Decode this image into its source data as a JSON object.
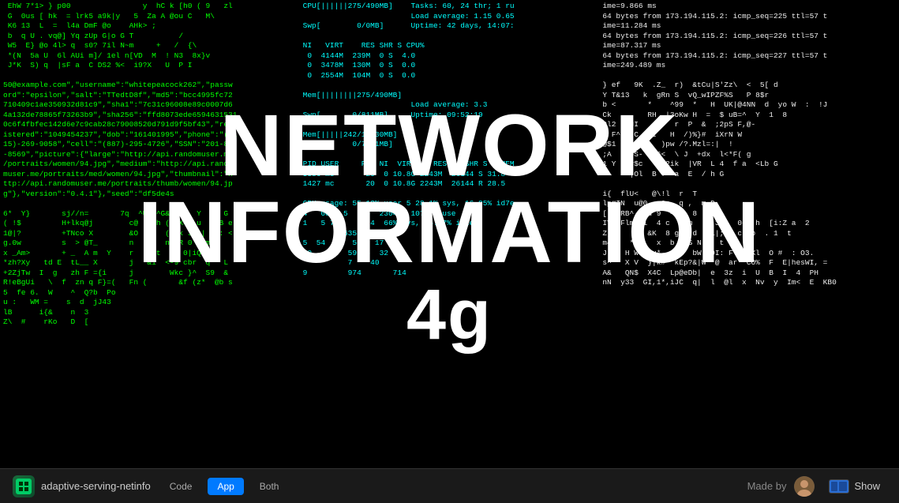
{
  "app": {
    "name": "adaptive-serving-netinfo",
    "icon_label": "net"
  },
  "tabs": [
    {
      "id": "code",
      "label": "Code",
      "active": false
    },
    {
      "id": "app",
      "label": "App",
      "active": true
    },
    {
      "id": "both",
      "label": "Both",
      "active": false
    }
  ],
  "overlay": {
    "line1": "NETWORK",
    "line2": "INFORMATION",
    "line3": "4g"
  },
  "bottom_right": {
    "made_by": "Made by",
    "show_label": "Show"
  },
  "terminal": {
    "col1_lines": [
      " EhW 7*1> } p00                y  hC k [h0 ( 9   zl",
      " G  0us [ hk  = lrk5 a9k|y   5  Za A @ou C   M\\",
      " K6 13  L  =  l4a DmF @o    AHk> ;                ",
      " b  q U . vq@] Yq zUp G|o G T          / ",
      " W5  E} @o 4l> q  s0? 7il N~m     +   /  {\\",
      " *(N  5a U  6l AUi m]/ 1el n[VD  M  ! N3  8x}v",
      " J*K  S) q  |sF a  C DS2 %<  i9?X   U  P I",
      "",
      "50@example.com\",\"username\":\"whitepeacock262\",\"passw",
      "ord\":\"epsilon\",\"salt\":\"TTedtD8f\",\"md5\":\"bcc4995fc72",
      "710409c1ae350932d81c9\",\"sha1\":\"7c31c96008e89c0007d6",
      "4a132de78865f73263b9\",\"sha256\":\"ffd8073ede6594631531",
      "0c6f4fbfec142d6e7c9cab28c79008520d791d9f5bf43\",\"reg",
      "istered\":\"1049454237\",\"dob\":\"161401995\",\"phone\":\"(31",
      "15)-269-9058\",\"cell\":\"(887)-295-4726\",\"SSN\":\"201-89",
      "-8569\",\"picture\":{\"large\":\"http://api.randomuser.me",
      "/portraits/women/94.jpg\",\"medium\":\"http://api.rando",
      "muser.me/portraits/med/women/94.jpg\",\"thumbnail\":\"h",
      "ttp://api.randomuser.me/portraits/thumb/women/94.jp",
      "g\"},\"version\":\"0.4.1\"},\"seed\":\"df5de4s",
      "",
      "6*  Y}       sj//n=       7q  ^U  ^G&F}!_  Y  ^K G",
      "( !$         H+lkq@j        c@   ah (X/X=  u  ^ B e S",
      "1@|?         +TNco X        &O   d  ( ok J?]| 1 : < ( D",
      "g.0w         s  > @T_       n    (  n* R 0  _m",
      "x _Am>       + _  A m  Y    r  - _t  'i 0|iQ M l",
      "*zh?Xy   td E  tL__ X       j   &i  <-9 cbr  q   L",
      "+2ZjTw  I  g   zh F ={i     j        Wkc }^  S9  &",
      "R!eBgUi   \\  f  zn q F}=(   Fn (       &f (z*  @b s",
      "5  fe 6.  W    ^  Q?b  Po",
      "u :   WM =    s  d  jJ43",
      "lB      i{&    n  3     ",
      "Z\\  #    rKo   D  [     "
    ],
    "col2_lines": [
      "CPU[||||||275/490MB]    Tasks: 60, 24 thr; 1 ru",
      "                        Load average: 1.15 0.65",
      "Swp[        0/0MB]      Uptime: 42 days, 14:07:",
      "",
      "NI   VIRT    RES SHR S CPU%",
      " 0  4144M  239M  0 S  4.0",
      " 0  3478M  130M  0 S  0.0",
      " 0  2554M  104M  0 S  0.0",
      "",
      "Mem[||||||||275/490MB]",
      "                        Load average: 3.3",
      "Swp[       0/811MB]     Uptime: 09:52:19",
      "",
      "Mem[|||||242/15930MB]",
      "Swp[       0/7811MB]",
      "",
      "PID USER     PRI NI  VIRT    RES    SHR S  %MEM",
      "3386 mc       20  0 10.8G 2243M  26144 S 31.8",
      "1427 mc       20  0 10.8G 2243M  26144 R 28.5",
      "",
      "CPU usage: 55.12% user 5 28.1% sys, 16.85% id7e",
      "4   0832 5   35  2304   107M unuse",
      "1   5 750    594  66% sys, 15.57% idle",
      "         63538",
      "5  54  4   56   17",
      "60        59 65  32",
      "          7    40",
      "9         974       714"
    ],
    "col3_lines": [
      "ime=9.866 ms",
      "64 bytes from 173.194.115.2: icmp_seq=225 ttl=57 t",
      "ime=11.284 ms",
      "64 bytes from 173.194.115.2: icmp_seq=226 ttl=57 t",
      "ime=87.317 ms",
      "64 bytes from 173.194.115.2: icmp_seq=227 ttl=57 t",
      "ime=249.489 ms",
      "",
      "} ef   9K  .Z_  r)  &tCu|S'Zz\\  <  5[ d",
      "Y T&13   k  gRn S  vQ_wIPZF%S   P 8$r",
      "b <       *    ^99  *   H  UK|@4NN  d  yo W  :  !J",
      "Ck        RH  |3oKw H  =  $ uB=^  Y  1  8",
      "9l2   NI        r  P  &  ;2pS F,@-",
      "{ F^   C   I   H  /)%}#  iXrN W",
      "@$1      T   )pw /?.Mzl=:|  !",
      ";A  b oS-  |6<  \\ J  +dx  l<*F( g",
      "1 Y   v$c     2ik  |VR  L 4  f a  <Lb G",
      "      |Ol  B ?  a  E  / h G",
      "",
      "i{  flU<   @\\!l  r  T",
      "lp#IN  u@0   Qp  q ,  m D",
      "[ |BRB^  Ou 9  ^iv  8",
      "IY  Flm  i  4 c  3 m  |$|3U-  0^  h  [i:Z a  2",
      "Z, K   Z  &K  8 g   d  -l|;$  c  b  . 1  t",
      "m4    *2/   x  b  bS N  ! t",
      "J Q  H W  Ou*  ^;c  bW h0I: F'  pXl  O #  : O3.",
      "s^   X V  }|k#  kEp?&|W  @  ar  CO%  F  E|hesWI, =",
      "A&   QN$  X4C  Lp@eDb|  e  3z  i  U  B  I  4  PH",
      "nN  y33  GI,1*,iJC  q|  l  @l  x  Nv  y  Im<  E  KB0"
    ]
  }
}
